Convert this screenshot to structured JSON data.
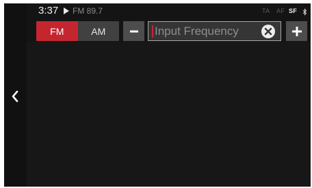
{
  "status_bar": {
    "time": "3:37",
    "source_icon": "play-icon",
    "now_playing": "FM 89.7",
    "flags": {
      "ta": "TA",
      "af": "AF",
      "sf": "SF"
    },
    "connectivity_icon": "bluetooth-icon"
  },
  "toolbar": {
    "bands": [
      {
        "label": "FM",
        "selected": true
      },
      {
        "label": "AM",
        "selected": false
      }
    ],
    "step_down_icon": "minus-icon",
    "step_up_icon": "plus-icon",
    "frequency_input": {
      "placeholder": "Input Frequency",
      "value": "",
      "clear_icon": "clear-x-icon"
    }
  },
  "navigation": {
    "back_icon": "chevron-left-icon"
  },
  "colors": {
    "accent": "#c4262f",
    "background": "#141414",
    "button_gray": "#4d4d4d",
    "inactive_band": "#414141",
    "dim_text": "#8a8a8a"
  }
}
